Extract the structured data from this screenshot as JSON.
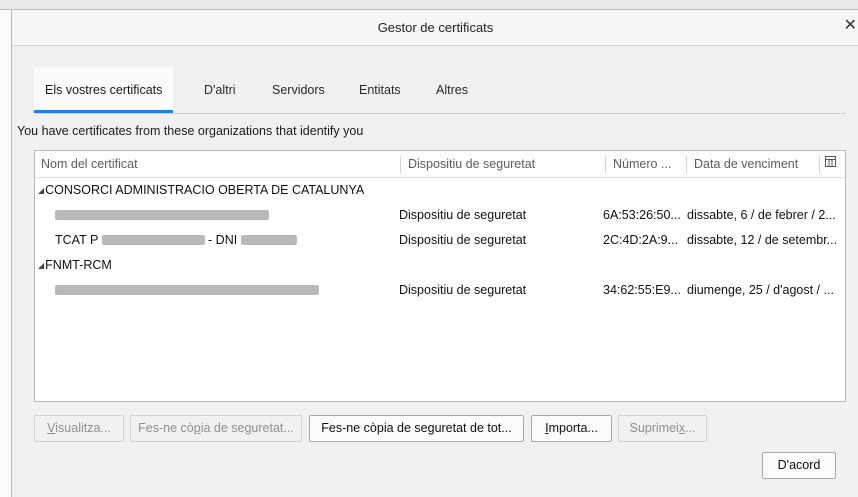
{
  "dialog": {
    "title": "Gestor de certificats",
    "close_icon": "close-icon"
  },
  "tabs": [
    {
      "label": "Els vostres certificats",
      "selected": true
    },
    {
      "label": "D'altri",
      "selected": false
    },
    {
      "label": "Servidors",
      "selected": false
    },
    {
      "label": "Entitats",
      "selected": false
    },
    {
      "label": "Altres",
      "selected": false
    }
  ],
  "description": "You have certificates from these organizations that identify you",
  "table": {
    "columns": [
      "Nom del certificat",
      "Dispositiu de seguretat",
      "Número ...",
      "Data de venciment"
    ],
    "column_picker_icon": "column-picker-icon",
    "groups": [
      {
        "name": "CONSORCI ADMINISTRACIO OBERTA DE CATALUNYA",
        "rows": [
          {
            "name_prefix": "",
            "name_suffix": "",
            "device": "Dispositiu de seguretat",
            "serial": "6A:53:26:50...",
            "expires": "dissabte, 6 / de febrer / 2..."
          },
          {
            "name_prefix": "TCAT P",
            "name_suffix": "- DNI",
            "device": "Dispositiu de seguretat",
            "serial": "2C:4D:2A:9...",
            "expires": "dissabte, 12 / de setembr..."
          }
        ]
      },
      {
        "name": "FNMT-RCM",
        "rows": [
          {
            "name_prefix": "",
            "name_suffix": "",
            "device": "Dispositiu de seguretat",
            "serial": "34:62:55:E9...",
            "expires": "diumenge, 25 / d'agost / ..."
          }
        ]
      }
    ]
  },
  "buttons": {
    "view": {
      "pre": "",
      "key": "V",
      "post": "isualitza..."
    },
    "backup": {
      "pre": "Fes-ne cò",
      "key": "p",
      "post": "ia de seguretat..."
    },
    "backup_all": {
      "pre": "Fes-ne còpia de se",
      "key": "g",
      "post": "uretat de tot..."
    },
    "import": {
      "pre": "",
      "key": "I",
      "post": "mporta..."
    },
    "delete": {
      "pre": "Suprimei",
      "key": "x",
      "post": "..."
    },
    "ok": "D'acord"
  }
}
